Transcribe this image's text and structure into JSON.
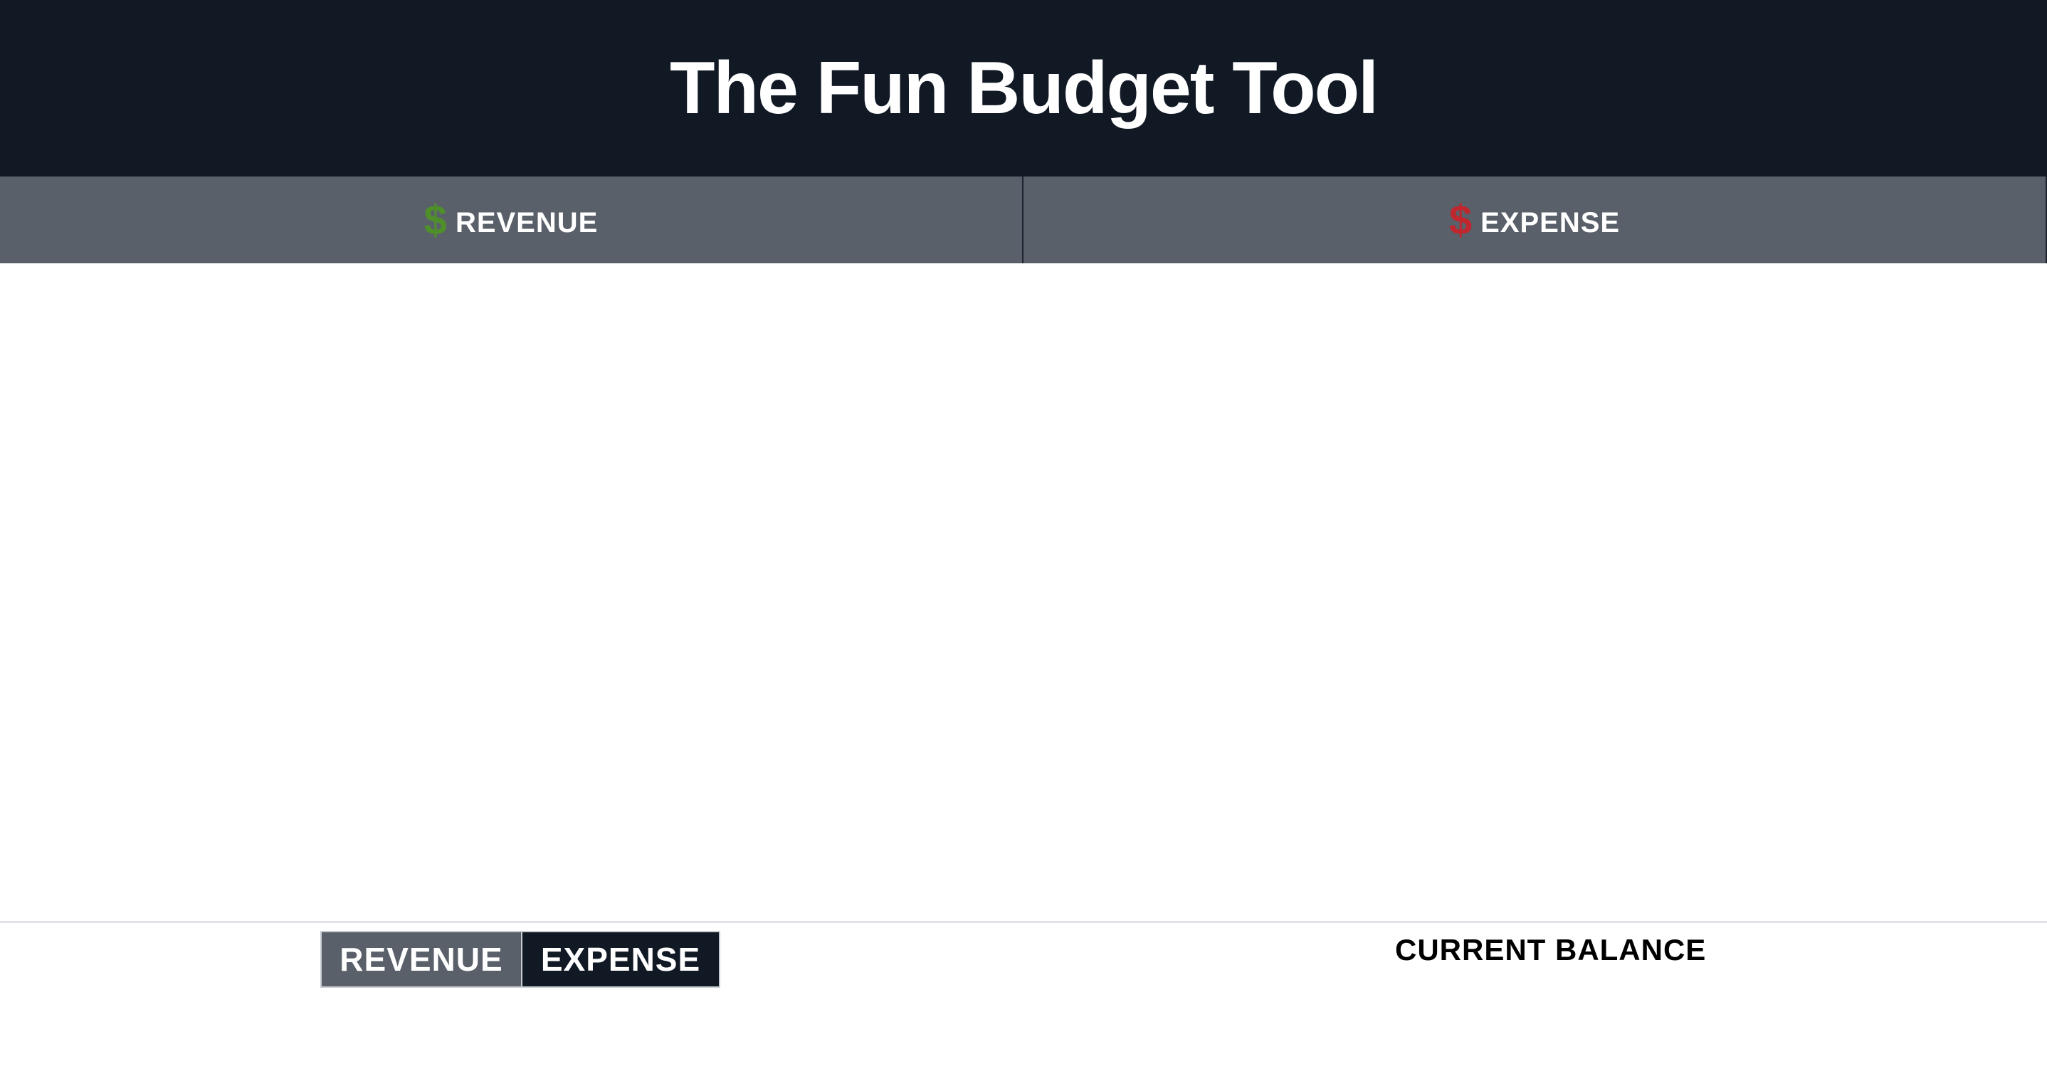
{
  "header": {
    "title": "The Fun Budget Tool"
  },
  "columns": {
    "revenue": {
      "icon_glyph": "$",
      "icon_name": "dollar-icon",
      "icon_color": "#4f8f2a",
      "label": "REVENUE"
    },
    "expense": {
      "icon_glyph": "$",
      "icon_name": "dollar-icon",
      "icon_color": "#c0262d",
      "label": "EXPENSE"
    }
  },
  "footer": {
    "toggle": {
      "revenue_label": "REVENUE",
      "expense_label": "EXPENSE",
      "selected": "REVENUE"
    },
    "balance_label": "CURRENT BALANCE"
  },
  "colors": {
    "header_bg": "#111925",
    "column_header_bg": "#5a6069",
    "revenue_icon": "#4f8f2a",
    "expense_icon": "#c0262d"
  }
}
